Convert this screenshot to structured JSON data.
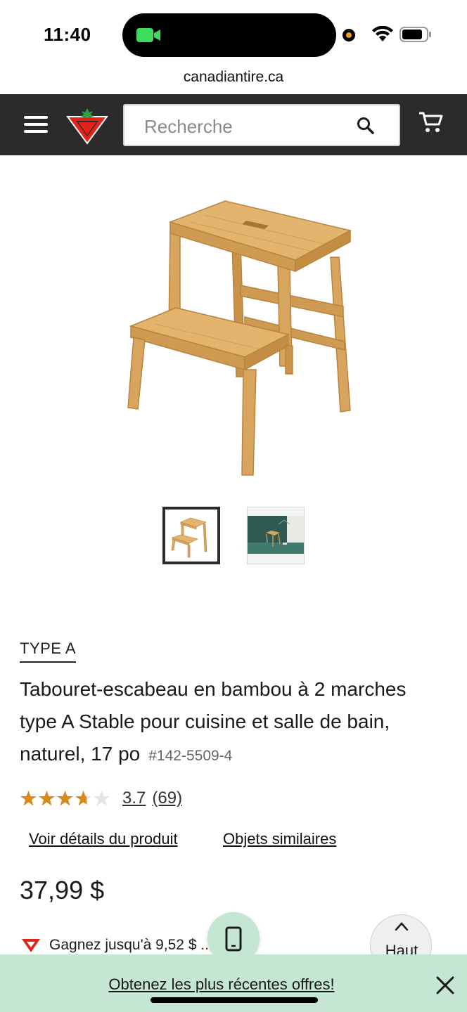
{
  "status_bar": {
    "time": "11:40"
  },
  "browser": {
    "url": "canadiantire.ca"
  },
  "header": {
    "search_placeholder": "Recherche"
  },
  "product": {
    "brand": "TYPE A",
    "title": "Tabouret-escabeau en bambou à 2 marches type A Stable pour cuisine et salle de bain, naturel, 17 po",
    "sku": "#142-5509-4",
    "rating": "3.7",
    "rating_value": 3.7,
    "rating_max": 5,
    "review_count": "(69)",
    "link_details": "Voir détails du produit",
    "link_similar": "Objets similaires",
    "price": "37,99 $",
    "ct_text": "Gagnez jusqu'à 9,52 $ ... CTᴹᴰ"
  },
  "top_button": {
    "label": "Haut"
  },
  "banner": {
    "text": "Obtenez les plus récentes offres!"
  },
  "colors": {
    "header_bg": "#2b2b2b",
    "banner_bg": "#c4e6d3",
    "star": "#d98a1a",
    "logo_red": "#e2231a",
    "camera_green": "#3ddc5c"
  },
  "icons": [
    "menu-icon",
    "canadian-tire-logo",
    "search-icon",
    "cart-icon",
    "star-icon",
    "phone-icon",
    "chevron-up-icon",
    "close-icon"
  ]
}
